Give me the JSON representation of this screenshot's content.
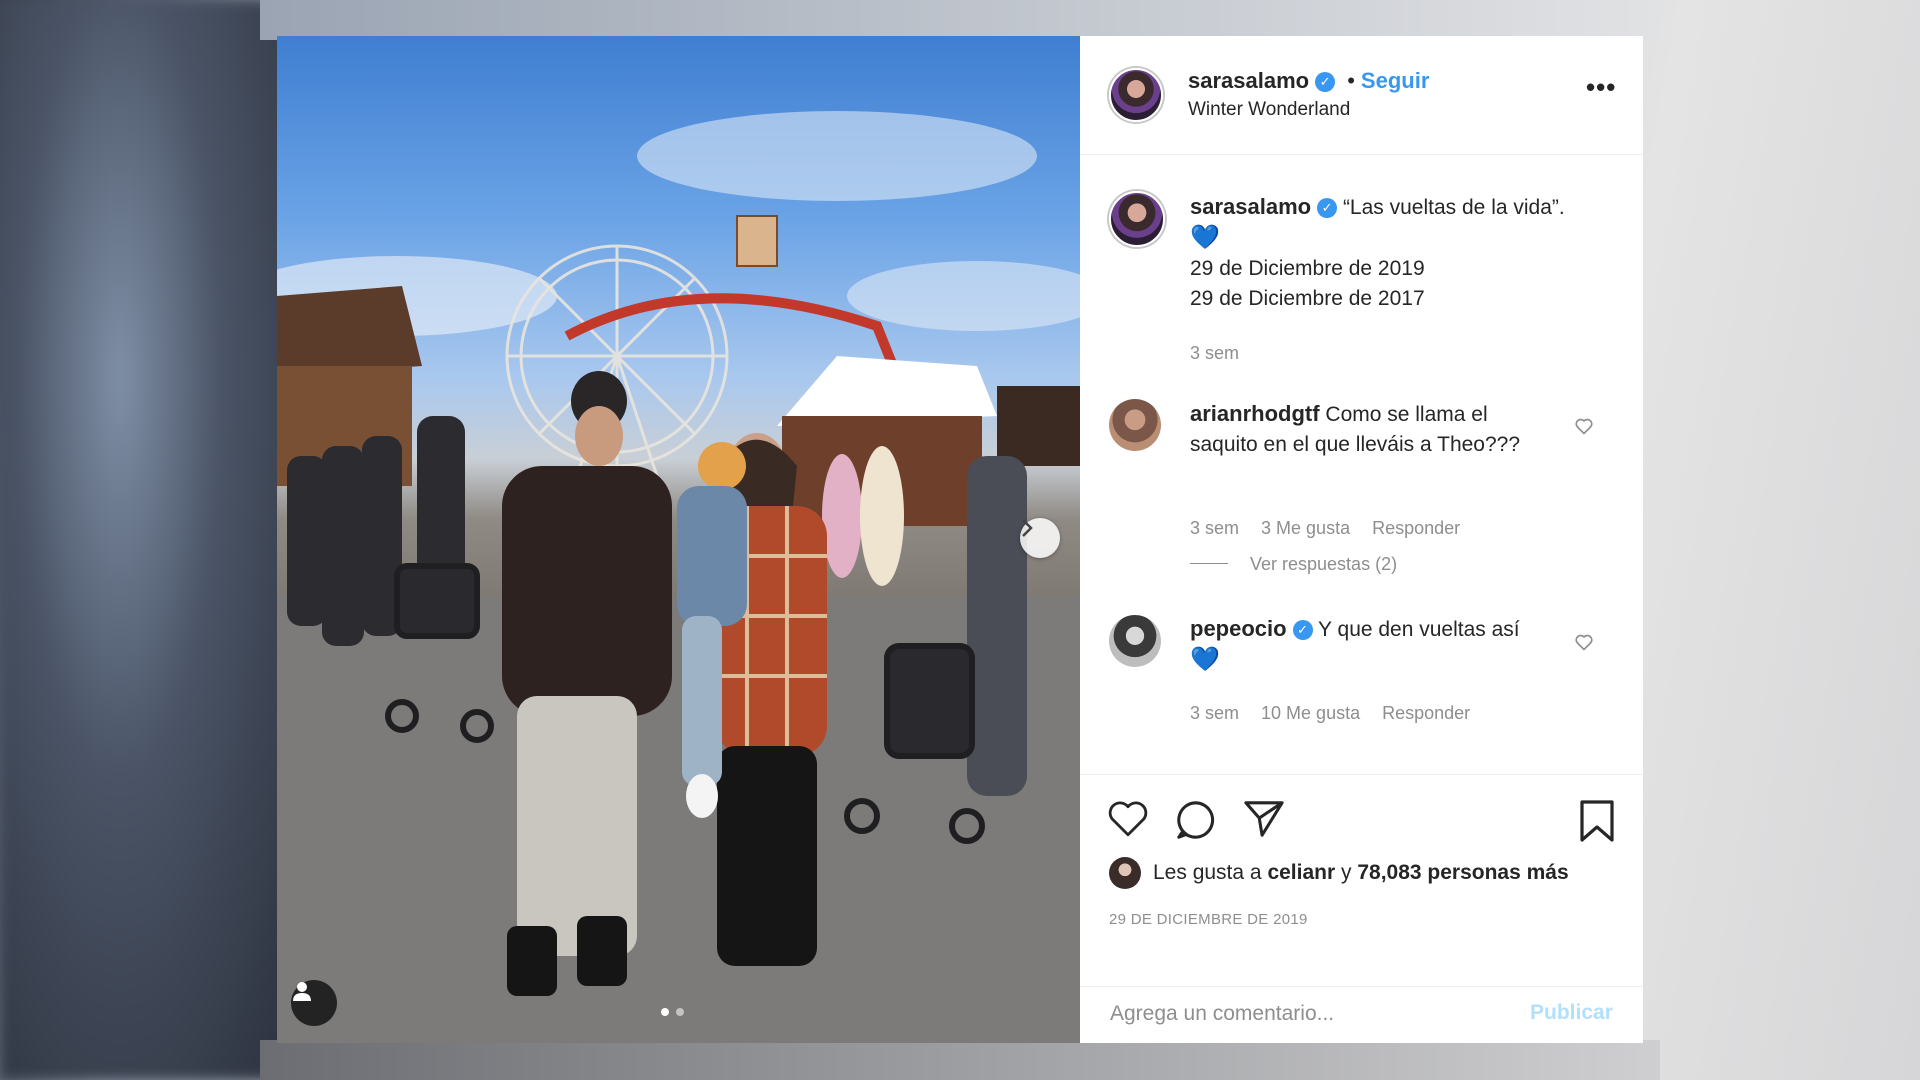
{
  "post": {
    "username": "sarasalamo",
    "separator": "•",
    "follow_label": "Seguir",
    "location": "Winter Wonderland",
    "more_label": "•••",
    "slide_count": 2,
    "active_slide": 1
  },
  "caption": {
    "username": "sarasalamo",
    "text": "“Las vueltas de la vida”.",
    "emoji": "💙",
    "line1": "29 de Diciembre de 2019",
    "line2": "29 de Diciembre de 2017",
    "time": "3 sem"
  },
  "comments": [
    {
      "username": "arianrhodgtf",
      "text": "Como se llama el saquito en el que lleváis a Theo???",
      "time": "3 sem",
      "likes": "3 Me gusta",
      "reply": "Responder",
      "view_replies": "Ver respuestas (2)"
    },
    {
      "username": "pepeocio",
      "text": "Y que den vueltas así",
      "emoji": "💙",
      "time": "3 sem",
      "likes": "10 Me gusta",
      "reply": "Responder"
    }
  ],
  "likes": {
    "prefix": "Les gusta a",
    "user": "celianr",
    "conj": "y",
    "count": "78,083 personas más"
  },
  "date": "29 DE DICIEMBRE DE 2019",
  "comment_box": {
    "placeholder": "Agrega un comentario...",
    "publish_label": "Publicar"
  },
  "colors": {
    "accent": "#3897f0",
    "text": "#262626",
    "muted": "#8e8e8e",
    "publish_disabled": "#b2dffc"
  }
}
